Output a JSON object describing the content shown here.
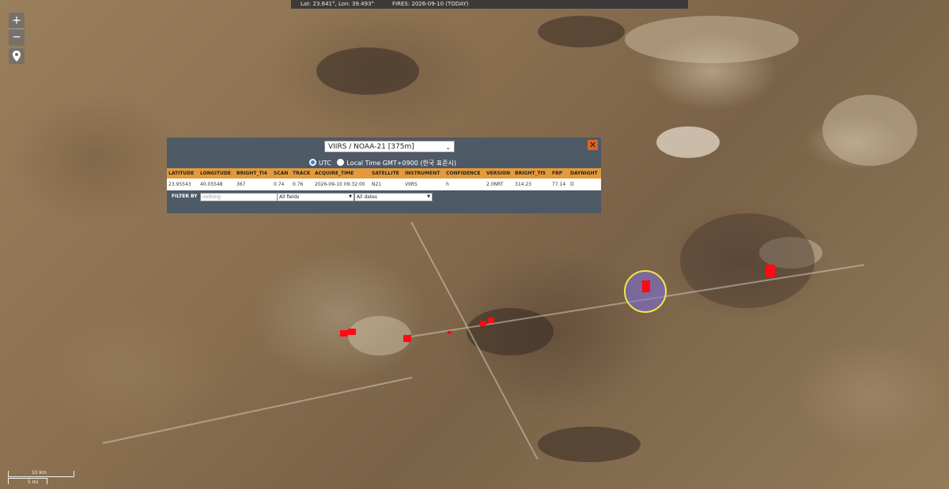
{
  "coordbar": {
    "position": "Lat: 23.641°, Lon: 39.493°",
    "fires": "FIRES: 2026-09-10 (TODAY)"
  },
  "zoom": {
    "in_label": "+",
    "out_label": "−"
  },
  "scale": {
    "metric": "10 km",
    "imperial": "5 mi"
  },
  "popup": {
    "satellite": "VIIRS / NOAA-21 [375m]",
    "close_label": "✕",
    "time_utc": "UTC",
    "time_local": "Local Time GMT+0900 (한국 표준시)",
    "columns": [
      "LATITUDE",
      "LONGITUDE",
      "BRIGHT_TI4",
      "SCAN",
      "TRACK",
      "ACQUIRE_TIME",
      "SATELLITE",
      "INSTRUMENT",
      "CONFIDENCE",
      "VERSION",
      "BRIGHT_TI5",
      "FRP",
      "DAYNIGHT"
    ],
    "row": [
      "23.95543",
      "40.05548",
      "367",
      "0.74",
      "0.76",
      "2026-09-10 09:32:00",
      "N21",
      "VIIRS",
      "h",
      "2.0NRT",
      "314.23",
      "77.14",
      "D"
    ],
    "filter_label": "FILTER BY",
    "filter_placeholder": "nothing",
    "fields_option": "All fields",
    "dates_option": "All dates"
  },
  "colors": {
    "fire": "#ff0a14",
    "highlight_ring": "#f2e64a",
    "header_bg": "#e49a3c",
    "popup_bg": "#4a5868",
    "close_btn": "#e0641e"
  }
}
